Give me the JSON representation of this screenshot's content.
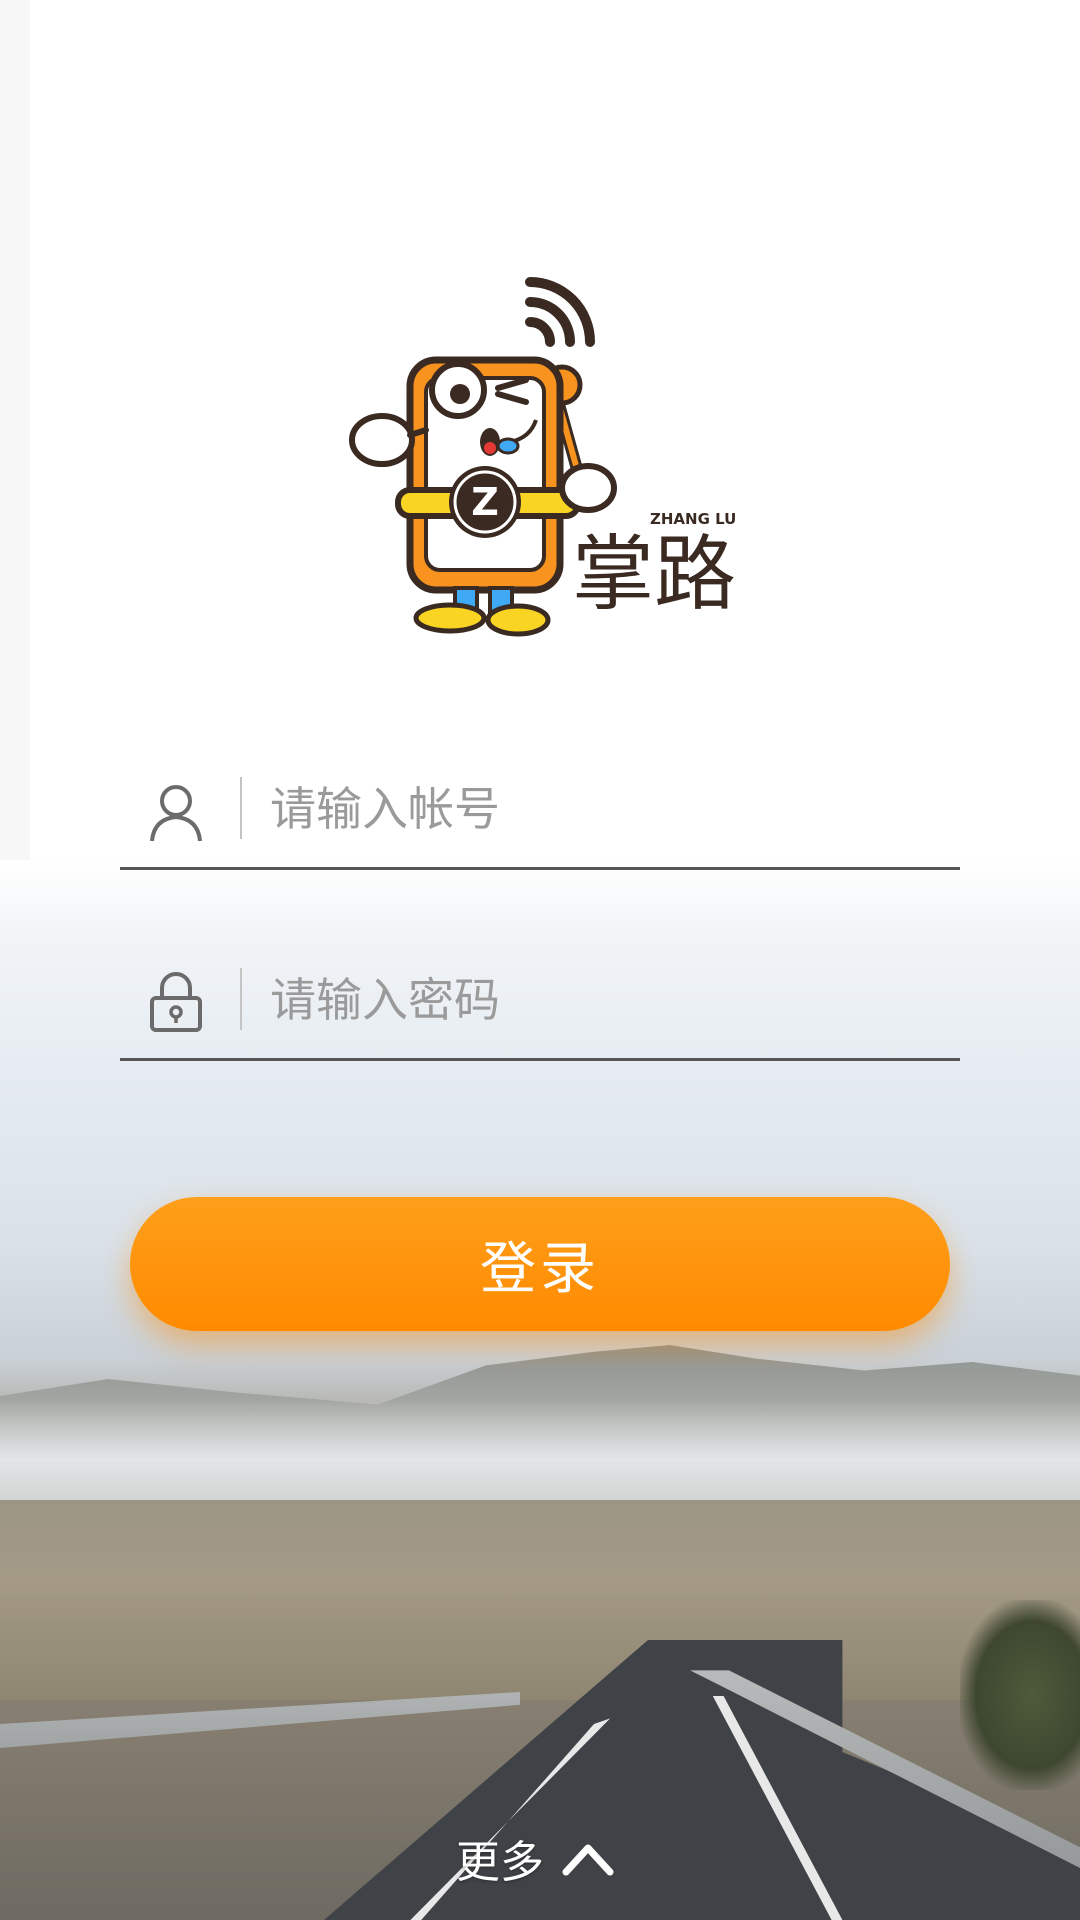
{
  "logo": {
    "brand_name": "掌路",
    "brand_latin": "ZHANG LU",
    "badge_letter": "Z",
    "orange": "#F7931E",
    "yellow": "#F9D423",
    "outline": "#3A2A22"
  },
  "form": {
    "account": {
      "icon": "user-icon",
      "placeholder": "请输入帐号",
      "value": ""
    },
    "password": {
      "icon": "lock-icon",
      "placeholder": "请输入密码",
      "value": ""
    }
  },
  "login_button": {
    "label": "登录",
    "color": "#FF8A00"
  },
  "more": {
    "label": "更多",
    "icon": "chevron-up-icon"
  }
}
